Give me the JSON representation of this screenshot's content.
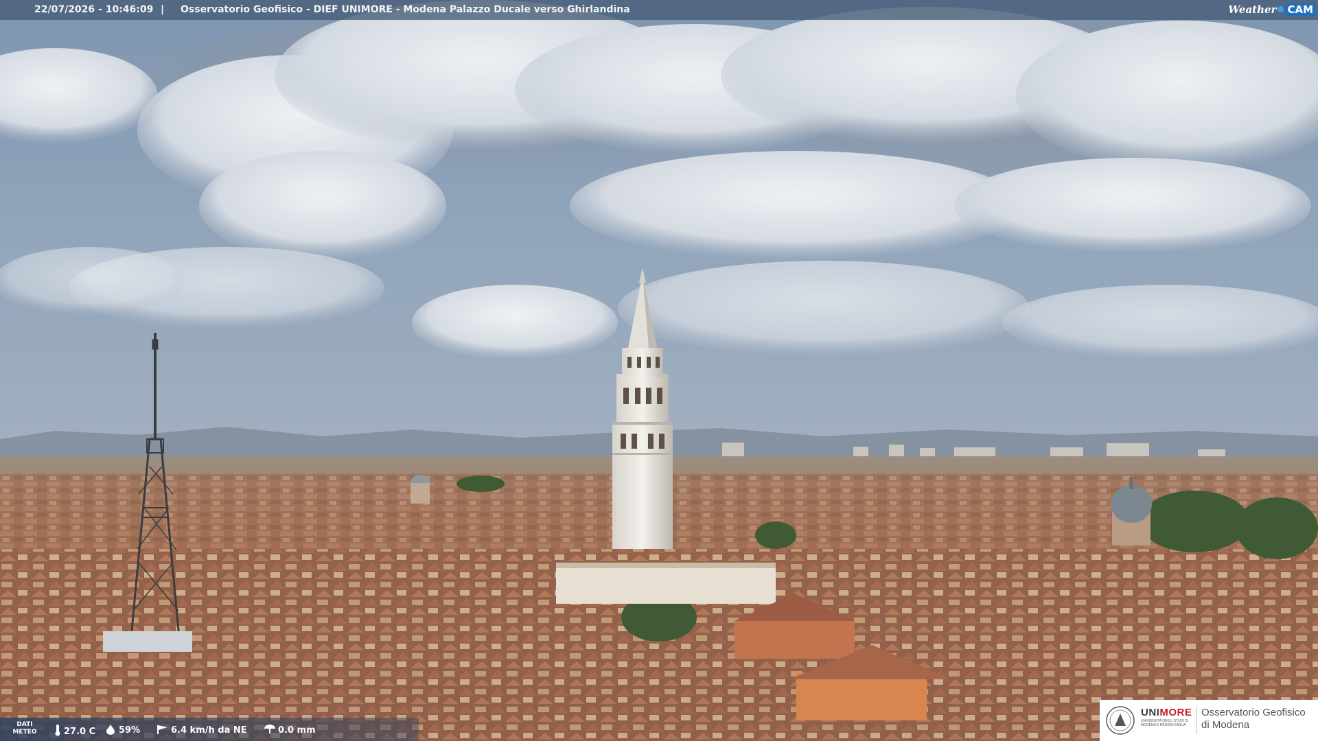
{
  "header": {
    "datetime": "22/07/2026 - 10:46:09",
    "separator": "|",
    "title": "Osservatorio Geofisico - DIEF UNIMORE - Modena Palazzo Ducale verso Ghirlandina"
  },
  "brand": {
    "weather": "Weather",
    "cam": "CAM",
    "accent": "#1f6fbf"
  },
  "meteo": {
    "label_line1": "DATI",
    "label_line2": "METEO",
    "temperature": "27.0 C",
    "humidity": "59%",
    "wind": "6.4 km/h da NE",
    "rain": "0.0 mm",
    "icons": [
      "thermometer-icon",
      "humidity-icon",
      "wind-icon",
      "rain-gauge-icon"
    ]
  },
  "logo": {
    "uni_a": "UNI",
    "uni_b": "MORE",
    "uni_sub": "UNIVERSITÀ DEGLI STUDI DI MODENA E REGGIO EMILIA",
    "org_line1": "Osservatorio Geofisico",
    "org_line2": "di Modena",
    "brand_red": "#c5202d"
  },
  "scene": {
    "subjects": [
      "ghirlandina-tower",
      "antenna-mast",
      "church-dome",
      "rooftops",
      "cloudy-sky"
    ]
  }
}
